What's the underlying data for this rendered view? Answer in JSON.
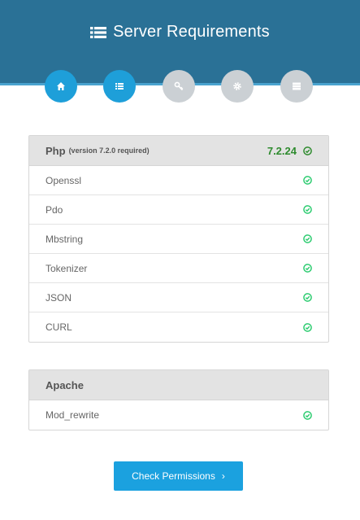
{
  "header": {
    "title": "Server Requirements",
    "title_icon": "list-icon"
  },
  "steps": [
    {
      "icon": "home-icon",
      "state": "done"
    },
    {
      "icon": "list-icon",
      "state": "active"
    },
    {
      "icon": "key-icon",
      "state": "pending"
    },
    {
      "icon": "gear-icon",
      "state": "pending"
    },
    {
      "icon": "server-icon",
      "state": "pending"
    }
  ],
  "php": {
    "title": "Php",
    "subtitle": "(version 7.2.0 required)",
    "version": "7.2.24",
    "extensions": [
      "Openssl",
      "Pdo",
      "Mbstring",
      "Tokenizer",
      "JSON",
      "CURL"
    ]
  },
  "apache": {
    "title": "Apache",
    "modules": [
      "Mod_rewrite"
    ]
  },
  "button": {
    "label": "Check Permissions",
    "chevron": "›"
  },
  "colors": {
    "header": "#2a7196",
    "accent": "#1ba1df",
    "ok": "#2ecc71",
    "version": "#2e8b2e",
    "pending": "#cbd0d4"
  }
}
